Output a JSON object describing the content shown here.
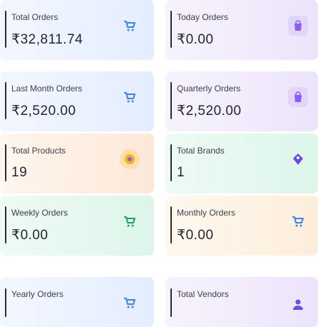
{
  "cards": [
    {
      "label": "Total Orders",
      "value": "₹32,811.74",
      "icon": "cart-icon"
    },
    {
      "label": "Today Orders",
      "value": "₹0.00",
      "icon": "bag-icon"
    },
    {
      "label": "Last Month Orders",
      "value": "₹2,520.00",
      "icon": "cart-icon"
    },
    {
      "label": "Quarterly Orders",
      "value": "₹2,520.00",
      "icon": "bag-icon"
    },
    {
      "label": "Total Products",
      "value": "19",
      "icon": "product-box-icon"
    },
    {
      "label": "Total Brands",
      "value": "1",
      "icon": "brand-tag-icon"
    },
    {
      "label": "Weekly Orders",
      "value": "₹0.00",
      "icon": "cart-icon"
    },
    {
      "label": "Monthly Orders",
      "value": "₹0.00",
      "icon": "cart-icon"
    },
    {
      "label": "Yearly Orders",
      "value": "",
      "icon": "cart-icon"
    },
    {
      "label": "Total Vendors",
      "value": "",
      "icon": "user-icon"
    }
  ],
  "colors": {
    "blue_card": "#eaf1ff",
    "purple_card": "#f1ecfb",
    "peach_card": "#fdf1e8",
    "mint_card": "#e9f8f1",
    "cream_card": "#fdf4e8",
    "icon_blue": "#3b82f6",
    "icon_purple": "#8b5cf6",
    "icon_yellow": "#f5b324",
    "icon_green": "#22c55e"
  }
}
